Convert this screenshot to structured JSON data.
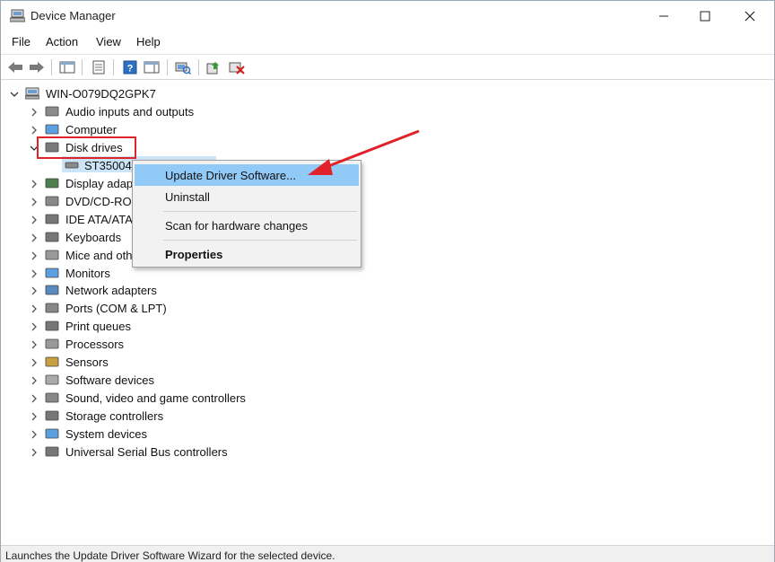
{
  "window": {
    "title": "Device Manager"
  },
  "menu": [
    "File",
    "Action",
    "View",
    "Help"
  ],
  "tree": {
    "root": "WIN-O079DQ2GPK7",
    "categories": [
      "Audio inputs and outputs",
      "Computer",
      "Disk drives",
      "Display adap",
      "DVD/CD-RO",
      "IDE ATA/ATA",
      "Keyboards",
      "Mice and oth",
      "Monitors",
      "Network adapters",
      "Ports (COM & LPT)",
      "Print queues",
      "Processors",
      "Sensors",
      "Software devices",
      "Sound, video and game controllers",
      "Storage controllers",
      "System devices",
      "Universal Serial Bus controllers"
    ],
    "disk_child": "ST35004"
  },
  "context_menu": {
    "update": "Update Driver Software...",
    "uninstall": "Uninstall",
    "scan": "Scan for hardware changes",
    "properties": "Properties"
  },
  "status": {
    "text": "Launches the Update Driver Software Wizard for the selected device."
  },
  "colors": {
    "highlight": "#e0222a",
    "menu_hover": "#91c9f7",
    "selection": "#cce4f7"
  }
}
